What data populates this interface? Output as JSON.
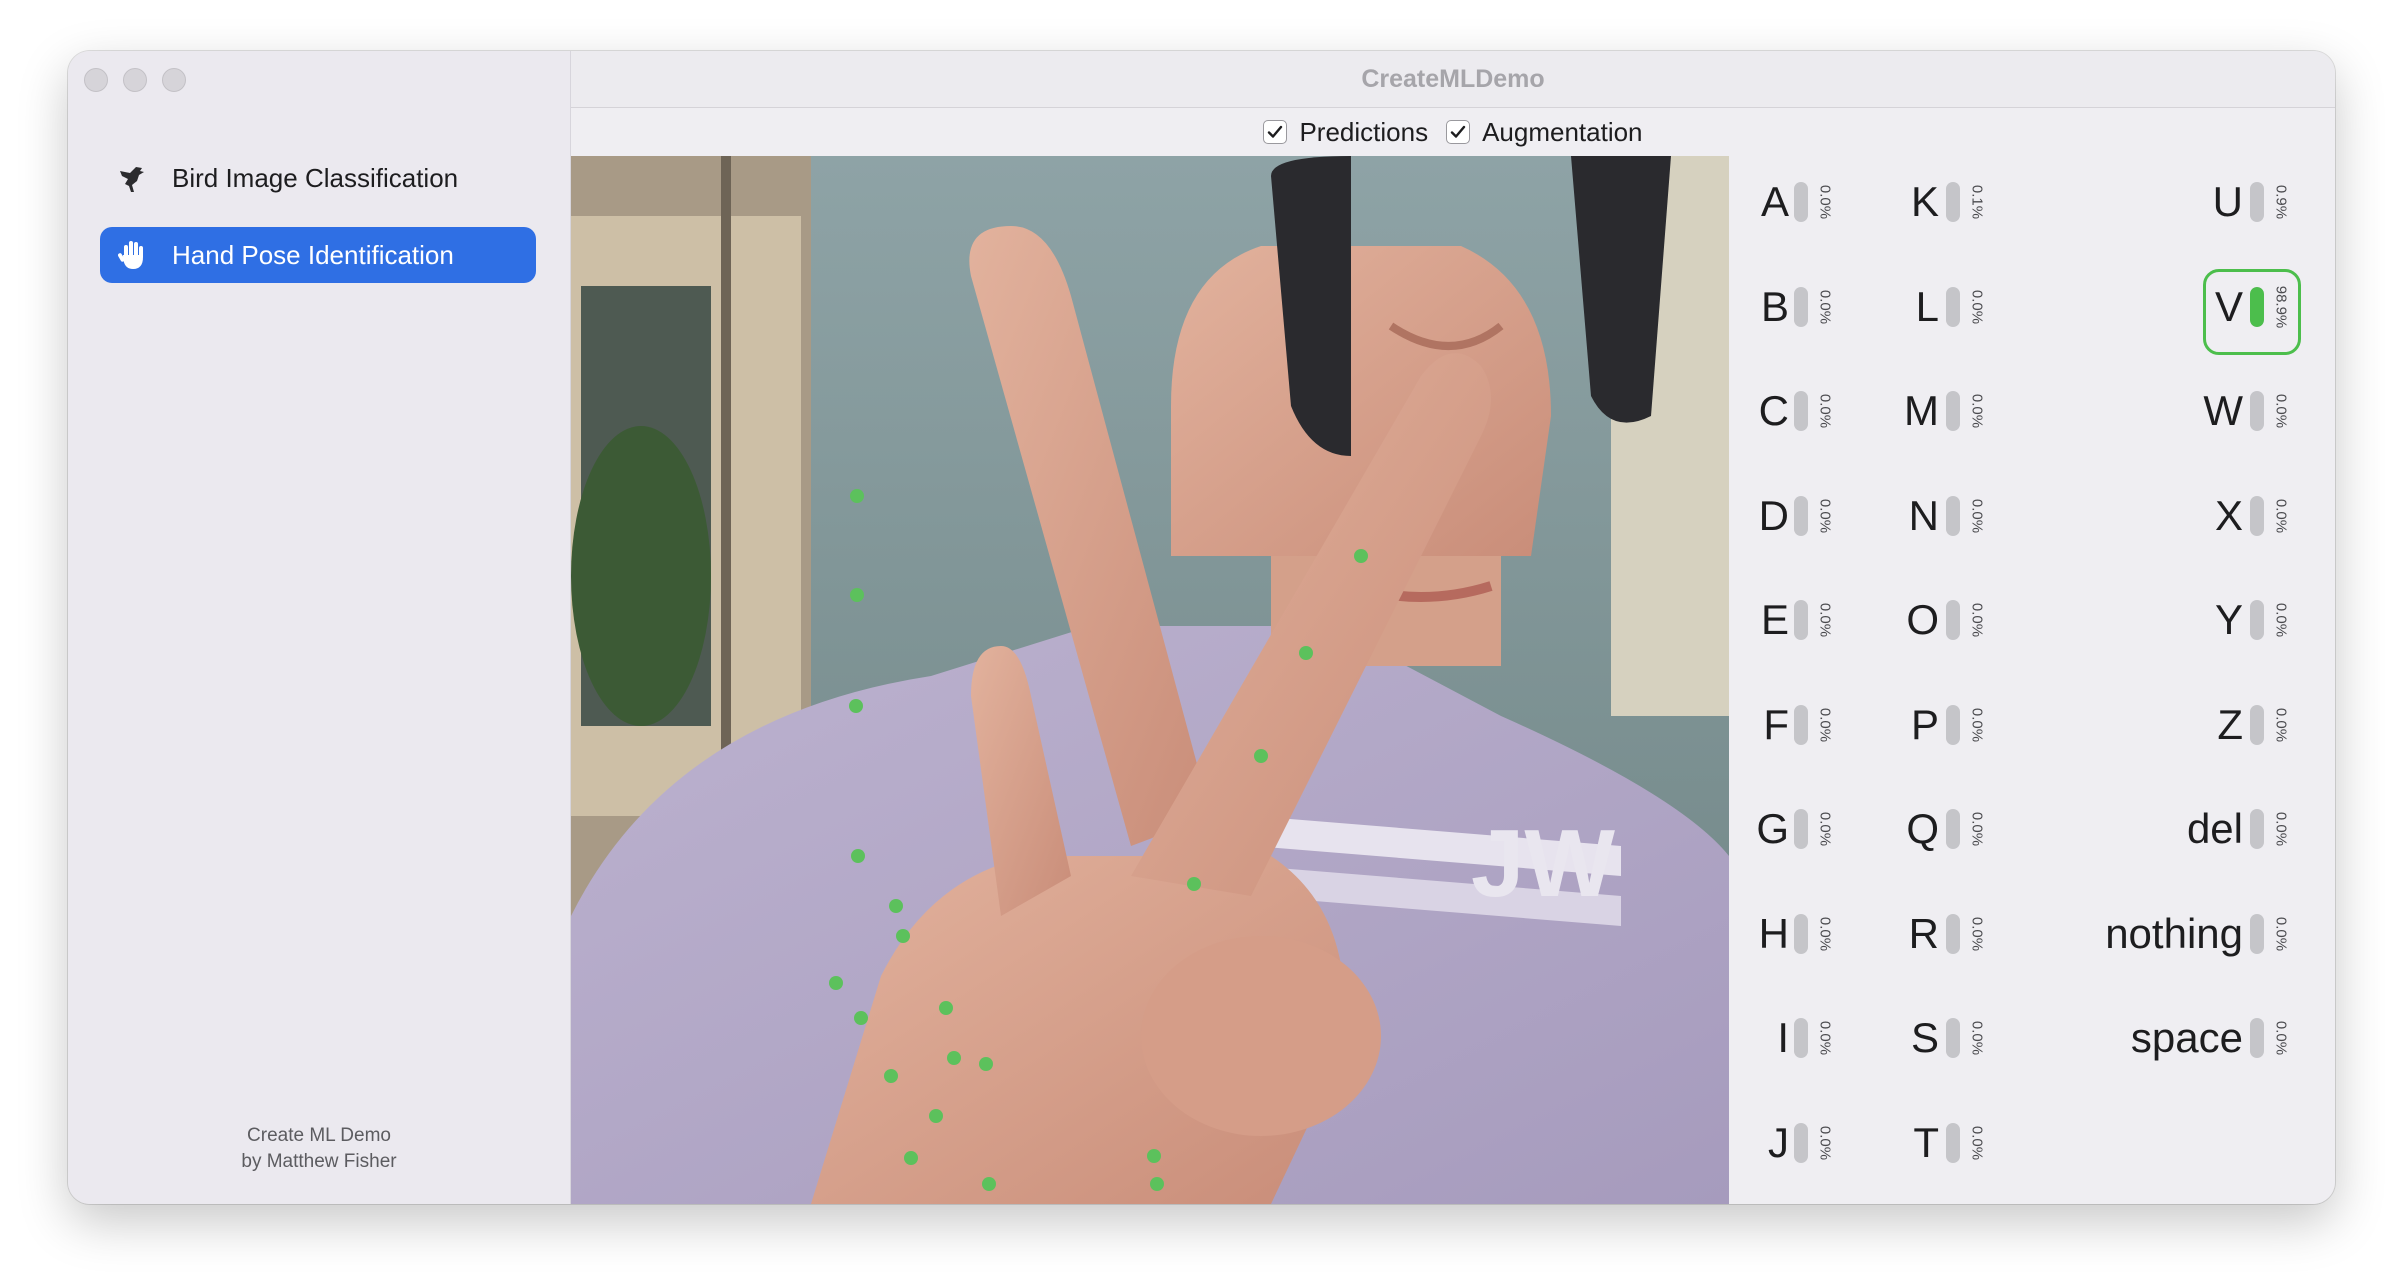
{
  "window": {
    "title": "CreateMLDemo"
  },
  "sidebar": {
    "items": [
      {
        "label": "Bird Image Classification",
        "icon": "bird-icon",
        "selected": false
      },
      {
        "label": "Hand Pose Identification",
        "icon": "hand-icon",
        "selected": true
      }
    ],
    "credit_line1": "Create ML Demo",
    "credit_line2": "by Matthew Fisher"
  },
  "toolbar": {
    "predictions_label": "Predictions",
    "predictions_checked": true,
    "augmentation_label": "Augmentation",
    "augmentation_checked": true
  },
  "camera": {
    "subject_shirt_text": "JW",
    "keypoint_color": "#5cc15c"
  },
  "predictions": {
    "bar_fill_color": "#4cbe4c",
    "bar_track_color": "#c5c5c9",
    "highlighted": "V",
    "columns": [
      [
        {
          "label": "A",
          "pct": "0.0%",
          "value": 0.0
        },
        {
          "label": "B",
          "pct": "0.0%",
          "value": 0.0
        },
        {
          "label": "C",
          "pct": "0.0%",
          "value": 0.0
        },
        {
          "label": "D",
          "pct": "0.0%",
          "value": 0.0
        },
        {
          "label": "E",
          "pct": "0.0%",
          "value": 0.0
        },
        {
          "label": "F",
          "pct": "0.0%",
          "value": 0.0
        },
        {
          "label": "G",
          "pct": "0.0%",
          "value": 0.0
        },
        {
          "label": "H",
          "pct": "0.0%",
          "value": 0.0
        },
        {
          "label": "I",
          "pct": "0.0%",
          "value": 0.0
        },
        {
          "label": "J",
          "pct": "0.0%",
          "value": 0.0
        }
      ],
      [
        {
          "label": "K",
          "pct": "0.1%",
          "value": 0.001
        },
        {
          "label": "L",
          "pct": "0.0%",
          "value": 0.0
        },
        {
          "label": "M",
          "pct": "0.0%",
          "value": 0.0
        },
        {
          "label": "N",
          "pct": "0.0%",
          "value": 0.0
        },
        {
          "label": "O",
          "pct": "0.0%",
          "value": 0.0
        },
        {
          "label": "P",
          "pct": "0.0%",
          "value": 0.0
        },
        {
          "label": "Q",
          "pct": "0.0%",
          "value": 0.0
        },
        {
          "label": "R",
          "pct": "0.0%",
          "value": 0.0
        },
        {
          "label": "S",
          "pct": "0.0%",
          "value": 0.0
        },
        {
          "label": "T",
          "pct": "0.0%",
          "value": 0.0
        }
      ],
      [
        {
          "label": "U",
          "pct": "0.9%",
          "value": 0.009
        },
        {
          "label": "V",
          "pct": "98.9%",
          "value": 0.989
        },
        {
          "label": "W",
          "pct": "0.0%",
          "value": 0.0
        },
        {
          "label": "X",
          "pct": "0.0%",
          "value": 0.0
        },
        {
          "label": "Y",
          "pct": "0.0%",
          "value": 0.0
        },
        {
          "label": "Z",
          "pct": "0.0%",
          "value": 0.0
        },
        {
          "label": "del",
          "pct": "0.0%",
          "value": 0.0
        },
        {
          "label": "nothing",
          "pct": "0.0%",
          "value": 0.0
        },
        {
          "label": "space",
          "pct": "0.0%",
          "value": 0.0
        }
      ]
    ]
  }
}
